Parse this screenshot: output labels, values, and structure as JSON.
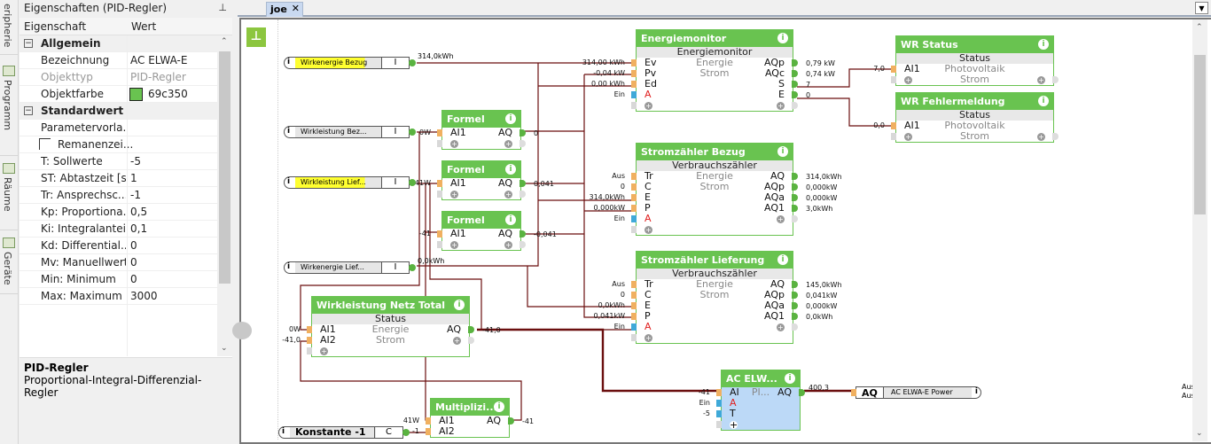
{
  "side_tabs": [
    {
      "label": "eripherie"
    },
    {
      "label": "Programm"
    },
    {
      "label": "Räume"
    },
    {
      "label": "Geräte"
    }
  ],
  "properties": {
    "title": "Eigenschaften (PID-Regler)",
    "pin_icon": "pin-icon",
    "col_property": "Eigenschaft",
    "col_value": "Wert",
    "rows": [
      {
        "type": "category",
        "key": "Allgemein"
      },
      {
        "key": "Bezeichnung",
        "value": "AC ELWA-E"
      },
      {
        "key": "Objekttyp",
        "value": "PID-Regler",
        "dim": true
      },
      {
        "key": "Objektfarbe",
        "value": "69c350",
        "swatch": "#69c350"
      },
      {
        "type": "category",
        "key": "Standardwert"
      },
      {
        "key": "Parametervorla...",
        "value": ""
      },
      {
        "key": "Remanenzei...",
        "value": "",
        "checkbox": true
      },
      {
        "key": "T: Sollwerte",
        "value": "-5"
      },
      {
        "key": "ST: Abtastzeit [s]",
        "value": "1"
      },
      {
        "key": "Tr: Ansprechsc...",
        "value": "-1"
      },
      {
        "key": "Kp: Proportiona...",
        "value": "0,5"
      },
      {
        "key": "Ki: Integralanteil",
        "value": "0,1"
      },
      {
        "key": "Kd: Differential...",
        "value": "0"
      },
      {
        "key": "Mv: Manuellwert",
        "value": "0"
      },
      {
        "key": "Min: Minimum",
        "value": "0"
      },
      {
        "key": "Max: Maximum",
        "value": "3000"
      }
    ],
    "description_title": "PID-Regler",
    "description": "Proportional-Integral-Differenzial-Regler"
  },
  "editor": {
    "tab": "joe",
    "close_icon": "close-icon",
    "dropdown_icon": "chevron-down-icon",
    "pin_glyph": "⊥",
    "edge_labels": [
      "Aus",
      "Aus"
    ]
  },
  "colors": {
    "block": "#69c350",
    "pid_block": "#bcd9f7",
    "wire": "#6b0f0f",
    "highlight": "#ffff30"
  },
  "inputs": [
    {
      "id": "in1",
      "label": "Wirkenergie Bezug",
      "type": "I",
      "highlight": true,
      "value": "314,0kWh"
    },
    {
      "id": "in2",
      "label": "Wirkleistung  Bez...",
      "type": "I",
      "highlight": false,
      "value": "0W"
    },
    {
      "id": "in3",
      "label": "Wirkleistung  Lief...",
      "type": "I",
      "highlight": true,
      "value": "41W"
    },
    {
      "id": "in4",
      "label": "Wirkenergie  Lief...",
      "type": "I",
      "highlight": false,
      "value": "0,0kWh"
    },
    {
      "id": "in5",
      "label": "Konstante -1",
      "type": "C",
      "highlight": false,
      "value": "-1",
      "big": true
    }
  ],
  "output_ref": {
    "type": "AQ",
    "label": "AC ELWA-E Power",
    "value": "400,3"
  },
  "blocks": [
    {
      "id": "energiemonitor",
      "title": "Energiemonitor",
      "subtitle": "Energiemonitor",
      "rows": [
        {
          "in": "Ev",
          "in_value": "314,00 kWh",
          "center": "Energie",
          "out": "AQp",
          "out_value": "0,79 kW"
        },
        {
          "in": "Pv",
          "in_value": "-0,04 kW",
          "center": "Strom",
          "out": "AQc",
          "out_value": "0,74 kW"
        },
        {
          "in": "Ed",
          "in_value": "0,00 kWh",
          "out": "S",
          "out_value": "7"
        },
        {
          "in": "A",
          "in_value": "Ein",
          "enable": true,
          "out": "E",
          "out_value": "0"
        },
        {
          "add_in": true,
          "add_out": true
        }
      ]
    },
    {
      "id": "bezug",
      "title": "Stromzähler Bezug",
      "subtitle": "Verbrauchszähler",
      "rows": [
        {
          "in": "Tr",
          "in_value": "Aus",
          "center": "Energie",
          "out": "AQ",
          "out_value": "314,0kWh"
        },
        {
          "in": "C",
          "in_value": "0",
          "center": "Strom",
          "out": "AQp",
          "out_value": "0,000kW"
        },
        {
          "in": "E",
          "in_value": "314,0kWh",
          "out": "AQa",
          "out_value": "0,000kW"
        },
        {
          "in": "P",
          "in_value": "0,000kW",
          "out": "AQ1",
          "out_value": "3,0kWh"
        },
        {
          "in": "A",
          "in_value": "Ein",
          "enable": true,
          "add_out": true
        },
        {
          "add_in": true
        }
      ]
    },
    {
      "id": "lieferung",
      "title": "Stromzähler Lieferung",
      "subtitle": "Verbrauchszähler",
      "rows": [
        {
          "in": "Tr",
          "in_value": "Aus",
          "center": "Energie",
          "out": "AQ",
          "out_value": "145,0kWh"
        },
        {
          "in": "C",
          "in_value": "0",
          "center": "Strom",
          "out": "AQp",
          "out_value": "0,041kW"
        },
        {
          "in": "E",
          "in_value": "0,0kWh",
          "out": "AQa",
          "out_value": "0,000kW"
        },
        {
          "in": "P",
          "in_value": "0,041kW",
          "out": "AQ1",
          "out_value": "0,0kWh"
        },
        {
          "in": "A",
          "in_value": "Ein",
          "enable": true,
          "add_out": true
        },
        {
          "add_in": true
        }
      ]
    },
    {
      "id": "formel1",
      "title": "Formel",
      "rows": [
        {
          "in": "AI1",
          "in_value": "0W",
          "out": "AQ",
          "out_value": "0"
        },
        {
          "add_in": true,
          "add_out": true
        }
      ]
    },
    {
      "id": "formel2",
      "title": "Formel",
      "rows": [
        {
          "in": "AI1",
          "in_value": "41W",
          "out": "AQ",
          "out_value": "0,041"
        },
        {
          "add_in": true,
          "add_out": true
        }
      ]
    },
    {
      "id": "formel3",
      "title": "Formel",
      "rows": [
        {
          "in": "AI1",
          "in_value": "-41",
          "out": "AQ",
          "out_value": "-0,041"
        },
        {
          "add_in": true,
          "add_out": true
        }
      ]
    },
    {
      "id": "wrstatus",
      "title": "WR Status",
      "subtitle": "Status",
      "rows": [
        {
          "in": "AI1",
          "in_value": "7,0",
          "center": "Photovoltaik"
        },
        {
          "add_in": true,
          "center": "Strom",
          "add_out": true
        }
      ]
    },
    {
      "id": "wrfehler",
      "title": "WR Fehlermeldung",
      "subtitle": "Status",
      "rows": [
        {
          "in": "AI1",
          "in_value": "0,0",
          "center": "Photovoltaik"
        },
        {
          "add_in": true,
          "center": "Strom",
          "add_out": true
        }
      ]
    },
    {
      "id": "netztotal",
      "title": "Wirkleistung Netz Total",
      "subtitle": "Status",
      "rows": [
        {
          "in": "AI1",
          "in_value": "0W",
          "center": "Energie",
          "out": "AQ",
          "out_value": "-41,0"
        },
        {
          "in": "AI2",
          "in_value": "-41,0",
          "center": "Strom",
          "add_out": true
        },
        {
          "add_in": true
        }
      ]
    },
    {
      "id": "multi",
      "title": "Multiplizi...",
      "rows": [
        {
          "in": "AI1",
          "in_value": "41W",
          "out": "AQ",
          "out_value": "-41"
        },
        {
          "in": "AI2",
          "in_value": "-1"
        }
      ]
    },
    {
      "id": "pid",
      "title": "AC ELW...",
      "pid": true,
      "rows": [
        {
          "in": "AI",
          "in_value": "-41",
          "center": "PI...",
          "out": "AQ",
          "out_value": "400,3"
        },
        {
          "in": "A",
          "in_value": "Ein",
          "enable": true
        },
        {
          "in": "T",
          "in_value": "-5",
          "blue": true
        },
        {
          "in": "+",
          "add_text": true
        }
      ]
    }
  ]
}
